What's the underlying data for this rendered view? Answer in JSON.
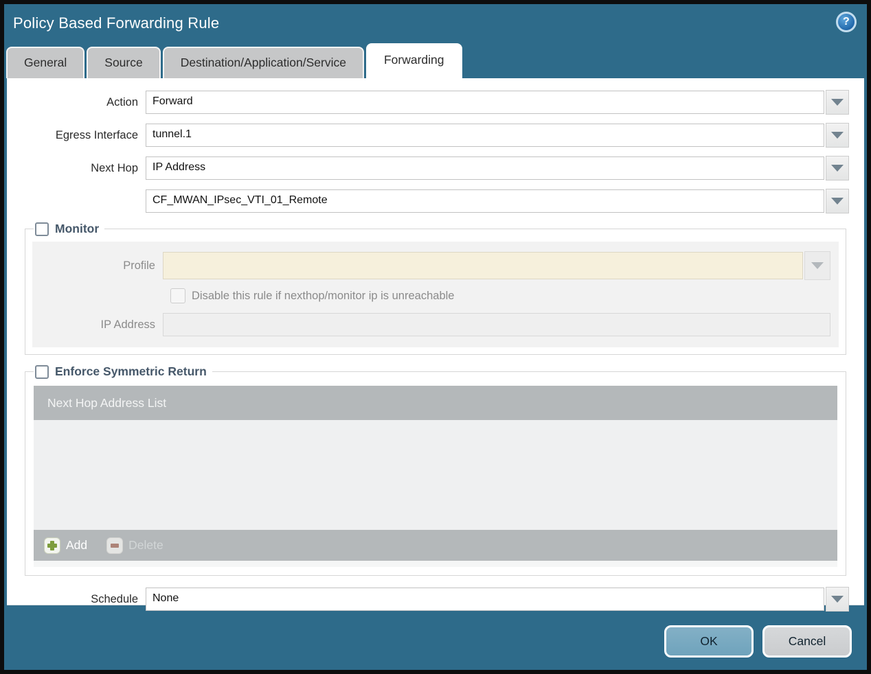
{
  "window": {
    "title": "Policy Based Forwarding Rule"
  },
  "icons": {
    "help": "?"
  },
  "tabs": [
    {
      "label": "General",
      "active": false
    },
    {
      "label": "Source",
      "active": false
    },
    {
      "label": "Destination/Application/Service",
      "active": false
    },
    {
      "label": "Forwarding",
      "active": true
    }
  ],
  "form": {
    "action": {
      "label": "Action",
      "value": "Forward"
    },
    "egress_interface": {
      "label": "Egress Interface",
      "value": "tunnel.1"
    },
    "next_hop": {
      "label": "Next Hop",
      "value": "IP Address"
    },
    "next_hop_address": {
      "value": "CF_MWAN_IPsec_VTI_01_Remote"
    },
    "schedule": {
      "label": "Schedule",
      "value": "None"
    }
  },
  "monitor": {
    "legend": "Monitor",
    "checked": false,
    "profile": {
      "label": "Profile",
      "value": ""
    },
    "disable_rule_checkbox": {
      "label": "Disable this rule if nexthop/monitor ip is unreachable",
      "checked": false
    },
    "ip_address": {
      "label": "IP Address",
      "value": ""
    }
  },
  "enforce_symmetric_return": {
    "legend": "Enforce Symmetric Return",
    "checked": false,
    "table": {
      "header": "Next Hop Address List",
      "rows": []
    },
    "toolbar": {
      "add_label": "Add",
      "delete_label": "Delete",
      "delete_enabled": false
    }
  },
  "footer": {
    "ok_label": "OK",
    "cancel_label": "Cancel"
  },
  "colors": {
    "titlebar": "#2e6b8a",
    "active_tab": "#ffffff",
    "inactive_tab": "#c6c7c8",
    "table_header": "#b4b8ba",
    "disabled_field": "#f6f0dc",
    "add_green": "#7e9d3d",
    "ok_button": "#6fa3bc",
    "cancel_button": "#caccce"
  }
}
